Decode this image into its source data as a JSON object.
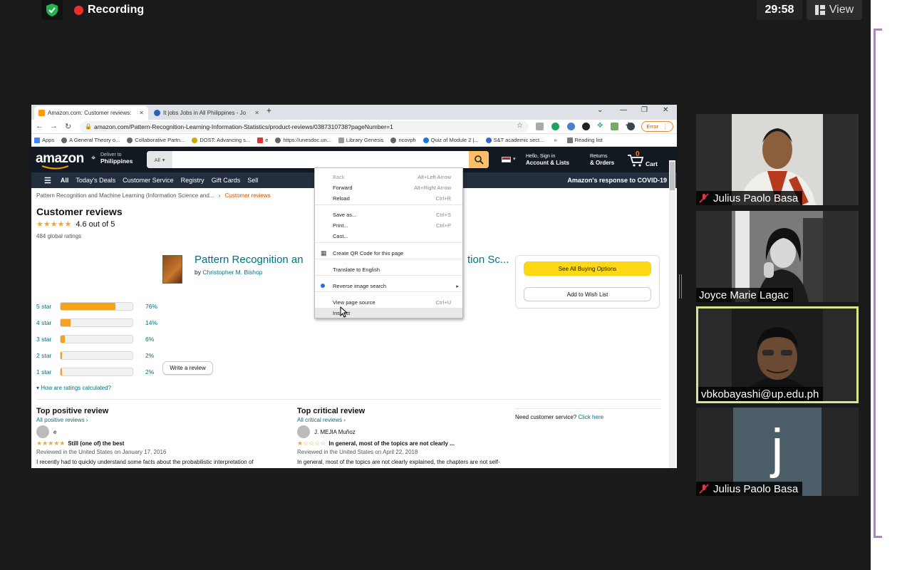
{
  "meeting": {
    "recording_label": "Recording",
    "timer": "29:58",
    "view_label": "View",
    "colors": {
      "record": "#e8312f",
      "active_speaker": "#d5e88a",
      "shield": "#23b14d"
    }
  },
  "browser": {
    "tabs": [
      {
        "label": "Amazon.com: Customer reviews:",
        "active": true
      },
      {
        "label": "It jobs Jobs in All Philippines - Jo",
        "active": false
      }
    ],
    "new_tab": "+",
    "url": "amazon.com/Pattern-Recognition-Learning-Information-Statistics/product-reviews/0387310738?pageNumber=1",
    "error_label": "Error",
    "bookmarks": [
      "Apps",
      "A General Theory o...",
      "Collaborative Partn...",
      "DOST: Advancing s...",
      "e",
      "https://unesdoc.un...",
      "Library Genesis",
      "ncovph",
      "Quiz of Module 2 |...",
      "S&T academic sect..."
    ],
    "bookmarks_more": "»",
    "reading_list": "Reading list"
  },
  "amazon": {
    "logo": "amazon",
    "deliver_line1": "Deliver to",
    "deliver_line2": "Philippines",
    "search_category": "All",
    "account_line1": "Hello, Sign in",
    "account_line2": "Account & Lists",
    "returns_line1": "Returns",
    "returns_line2": "& Orders",
    "cart_count": "0",
    "cart_label": "Cart",
    "nav": [
      "All",
      "Today's Deals",
      "Customer Service",
      "Registry",
      "Gift Cards",
      "Sell"
    ],
    "covid": "Amazon's response to COVID-19",
    "breadcrumb": "Pattern Recognition and Machine Learning (Information Science and...",
    "breadcrumb_sep": "›",
    "breadcrumb_current": "Customer reviews",
    "heading": "Customer reviews",
    "rating_text": "4.6 out of 5",
    "global_ratings": "484 global ratings",
    "histogram": [
      {
        "label": "5 star",
        "percent": 76,
        "text": "76%"
      },
      {
        "label": "4 star",
        "percent": 14,
        "text": "14%"
      },
      {
        "label": "3 star",
        "percent": 6,
        "text": "6%"
      },
      {
        "label": "2 star",
        "percent": 2,
        "text": "2%"
      },
      {
        "label": "1 star",
        "percent": 2,
        "text": "2%"
      }
    ],
    "how_calculated": "How are ratings calculated?",
    "write_review": "Write a review",
    "product_title_a": "Pattern Recognition an",
    "product_title_b": "tion Sc...",
    "by_label": "by",
    "author": "Christopher M. Bishop",
    "see_all_buying": "See All Buying Options",
    "add_wishlist": "Add to Wish List",
    "top_positive": {
      "heading": "Top positive review",
      "link": "All positive reviews ›",
      "reviewer": "e",
      "stars": 5,
      "title": "Still (one of) the best",
      "date": "Reviewed in the United States on January 17, 2016",
      "body": "I recently had to quickly understand some facts about the probabilistic interpretation of pca. Naturally I picked up this book and it didn't disappoint. Bishop is absolutely clear, and an excellent writer as well."
    },
    "top_critical": {
      "heading": "Top critical review",
      "link": "All critical reviews ›",
      "reviewer": "J. MEJIA Muñoz",
      "stars": 1,
      "title": "In general, most of the topics are not clearly ...",
      "date": "Reviewed in the United States on April 22, 2018",
      "body": "In general, most of the topics are not clearly explained, the chapters are not self-contained. In addition, most of the problems at the end of the chapters, consist in completing the steps between the book's"
    },
    "need_service": "Need customer service?",
    "click_here": "Click here"
  },
  "context_menu": [
    {
      "label": "Back",
      "shortcut": "Alt+Left Arrow",
      "disabled": true
    },
    {
      "label": "Forward",
      "shortcut": "Alt+Right Arrow",
      "disabled": false
    },
    {
      "label": "Reload",
      "shortcut": "Ctrl+R",
      "disabled": false
    },
    {
      "label": "Save as...",
      "shortcut": "Ctrl+S",
      "disabled": false
    },
    {
      "label": "Print...",
      "shortcut": "Ctrl+P",
      "disabled": false
    },
    {
      "label": "Cast...",
      "shortcut": "",
      "disabled": false
    },
    {
      "label": "Create QR Code for this page",
      "shortcut": "",
      "disabled": false
    },
    {
      "label": "Translate to English",
      "shortcut": "",
      "disabled": false
    },
    {
      "label": "Reverse image search",
      "shortcut": "",
      "disabled": false
    },
    {
      "label": "View page source",
      "shortcut": "Ctrl+U",
      "disabled": false
    },
    {
      "label": "Inspect",
      "shortcut": "",
      "disabled": false
    }
  ],
  "participants": [
    {
      "name": "Julius Paolo Basa",
      "muted": true
    },
    {
      "name": "Joyce Marie Lagac",
      "muted": false
    },
    {
      "name": "vbkobayashi@up.edu.ph",
      "muted": false,
      "active": true
    },
    {
      "name": "Julius Paolo Basa",
      "muted": true,
      "initial": "j"
    }
  ]
}
